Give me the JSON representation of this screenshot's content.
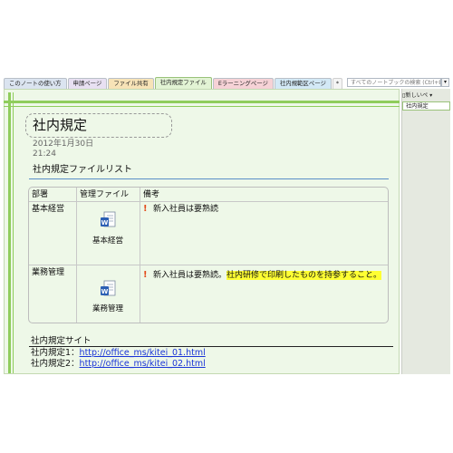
{
  "tabs": [
    {
      "label": "このノートの使い方",
      "color": "#dbe4f0"
    },
    {
      "label": "申請ページ",
      "color": "#e8e0f2"
    },
    {
      "label": "ファイル共有",
      "color": "#f7e3b7"
    },
    {
      "label": "社内規定ファイル",
      "color": "#e2f3d4"
    },
    {
      "label": "Eラーニングページ",
      "color": "#f6d2d6"
    },
    {
      "label": "社内規範区ページ",
      "color": "#d3e9f6"
    },
    {
      "label": "*",
      "color": "#f4f4f4"
    }
  ],
  "active_tab": 3,
  "search": {
    "placeholder": "すべてのノートブックの検索 (Ctrl+E)",
    "button_icon": "dropdown-search-icon"
  },
  "sidepane": {
    "new_page_label": "新しいペ ▾",
    "pages": [
      "社内規定"
    ]
  },
  "page": {
    "title": "社内規定",
    "date": "2012年1月30日",
    "time": "21:24",
    "section_title": "社内規定ファイルリスト",
    "table": {
      "headers": [
        "部署",
        "管理ファイル",
        "備考"
      ],
      "rows": [
        {
          "dept": "基本経営",
          "file_label": "基本経営",
          "note": "新入社員は要熟読",
          "note_highlight": ""
        },
        {
          "dept": "業務管理",
          "file_label": "業務管理",
          "note": "新入社員は要熟読。",
          "note_highlight": "社内研修で印刷したものを持参すること。"
        }
      ]
    },
    "sites": {
      "title": "社内規定サイト",
      "links": [
        {
          "label": "社内規定1：",
          "url": "http://office_ms/kitei_01.html"
        },
        {
          "label": "社内規定2：",
          "url": "http://office_ms/kitei_02.html"
        }
      ]
    }
  },
  "colors": {
    "accent_green": "#8fcd5c",
    "page_bg": "#eef8e8",
    "highlight": "#ffff33",
    "link": "#1a34d8",
    "warning": "#e34a1b"
  }
}
